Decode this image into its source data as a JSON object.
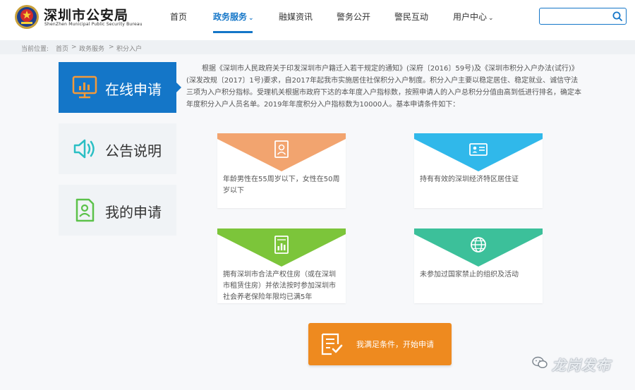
{
  "brand": {
    "title": "深圳市公安局",
    "subtitle": "ShenZhen Municipal Public Security Bureau"
  },
  "nav": [
    {
      "label": "首页"
    },
    {
      "label": "政务服务",
      "active": true,
      "has_dropdown": true
    },
    {
      "label": "融媒资讯"
    },
    {
      "label": "警务公开"
    },
    {
      "label": "警民互动"
    },
    {
      "label": "用户中心",
      "has_dropdown": true
    }
  ],
  "search": {
    "value": "",
    "placeholder": ""
  },
  "breadcrumb": {
    "prefix": "当前位置:",
    "items": [
      "首页",
      "政务服务",
      "积分入户"
    ],
    "separator": ">"
  },
  "sidebar": [
    {
      "label": "在线申请",
      "icon": "monitor-chart-icon",
      "active": true
    },
    {
      "label": "公告说明",
      "icon": "speaker-icon"
    },
    {
      "label": "我的申请",
      "icon": "user-document-icon"
    }
  ],
  "intro": "根据《深圳市人民政府关于印发深圳市户籍迁入若干规定的通知》(深府〔2016〕59号)及《深圳市积分入户办法(试行)》(深发改规〔2017〕1号)要求，自2017年起我市实施居住社保积分入户制度。积分入户主要以稳定居住、稳定就业、诚信守法三项为入户积分指标。受理机关根据市政府下达的本年度入户指标数，按照申请人的入户总积分分值由高到低进行排名，确定本年度积分入户人员名单。2019年年度积分入户指标数为10000人。基本申请条件如下：",
  "conditions": [
    {
      "text": "年龄男性在55周岁以下，女性在50周岁以下",
      "icon": "id-card-portrait-icon",
      "color": "#f2a46f"
    },
    {
      "text": "持有有效的深圳经济特区居住证",
      "icon": "residence-card-icon",
      "color": "#30b8ea"
    },
    {
      "text": "拥有深圳市合法产权住房（或在深圳市租赁住房）并依法按时参加深圳市社会养老保险年限均已满5年",
      "icon": "bar-chart-doc-icon",
      "color": "#7cc53a"
    },
    {
      "text": "未参加过国家禁止的组织及活动",
      "icon": "globe-icon",
      "color": "#3cc09a"
    }
  ],
  "apply_button": {
    "label": "我满足条件，开始申请",
    "icon": "form-check-icon",
    "color": "#ee8a1f"
  },
  "watermark": {
    "text": "龙岗发布",
    "icon": "wechat-icon"
  },
  "colors": {
    "primary": "#1476c8",
    "band": "#f7f8fa",
    "crumb_bar": "#eef1f4"
  }
}
